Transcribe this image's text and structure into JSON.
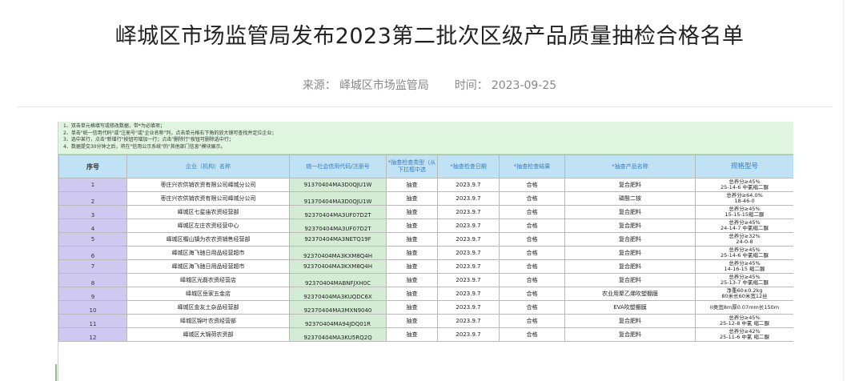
{
  "article": {
    "title": "峄城区市场监管局发布2023第二批次区级产品质量抽检合格名单",
    "source_label": "来源：",
    "source_value": "峄城区市场监管局",
    "time_label": "时间：",
    "time_value": "2023-09-25"
  },
  "sheet": {
    "notes": [
      "1、双击单元格填写或修改数据，带*为必填项；",
      "2、单击\"统一信用代码\"或\"注册号\"或\"企业名称\"列，点击单元格右下角的放大镜可查找并定位企业；",
      "3、选中某行，点击\"新增行\"按钮可增加一行；点击\"删除行\"按钮可删除选中行；",
      "4、数据提交30分钟之后，将在\"信用公示系统\"的\"其他部门信息\"模块展示。"
    ],
    "headers": [
      "序号",
      "企业（机构）名称",
      "统一社会信用代码/注册号",
      "*抽查检查类型（从下拉框中选",
      "*抽查检查日期",
      "*抽查检查结果",
      "*抽查产品名称",
      "规格型号"
    ],
    "rows": [
      {
        "seq": "1",
        "name": "枣庄兴农供销农资有限公司峄城分公司",
        "code": "91370404MA3D0QJU1W",
        "type": "抽查",
        "date": "2023.9.7",
        "result": "合格",
        "product": "复合肥料",
        "spec": "总养分≥45%\n25-14-6 中氯缩二脲",
        "low": false
      },
      {
        "seq": "2",
        "name": "枣庄兴农供销农资有限公司峄城分公司",
        "code": "91370404MA3D0QJU1W",
        "type": "抽查",
        "date": "2023.9.7",
        "result": "合格",
        "product": "磷酸二铵",
        "spec": "总养分≥64.0%\n18-46-0",
        "low": true
      },
      {
        "seq": "3",
        "name": "峄城区七星庙农资经营部",
        "code": "92370404MA3UF07D2T",
        "type": "抽查",
        "date": "2023.9.7",
        "result": "合格",
        "product": "复合肥料",
        "spec": "总养分≥45%\n15-15-15缩二脲",
        "low": true
      },
      {
        "seq": "4",
        "name": "峄城区左庄农资经营中心",
        "code": "92370404MA3UF07D2T",
        "type": "抽查",
        "date": "2023.9.7",
        "result": "合格",
        "product": "复合肥料",
        "spec": "总养分≥45%\n24-14-7 中氯缩二脲",
        "low": true
      },
      {
        "seq": "5",
        "name": "峄城区榴山镇为农农资销售经营部",
        "code": "92370404MA3NETQ19F",
        "type": "抽查",
        "date": "2023.9.7",
        "result": "合格",
        "product": "复合肥料",
        "spec": "总养分≥32%\n24-0-8",
        "low": false
      },
      {
        "seq": "6",
        "name": "峄城区海飞驰日用品经营超市",
        "code": "92370404MA3KXM8Q4H",
        "type": "抽查",
        "date": "2023.9.7",
        "result": "合格",
        "product": "复合肥料",
        "spec": "总养分≥45%\n25-14-6 中氯缩二脲",
        "low": true
      },
      {
        "seq": "7",
        "name": "峄城区海飞驰日用品经营超市",
        "code": "92370404MA3KXM8Q4H",
        "type": "抽查",
        "date": "2023.9.7",
        "result": "合格",
        "product": "复合肥料",
        "spec": "总养分≥45%\n14-16-15 缩二脲",
        "low": false
      },
      {
        "seq": "8",
        "name": "峄城区光磊农资经营店",
        "code": "92370404MABNFJXH0C",
        "type": "抽查",
        "date": "2023.9.7",
        "result": "合格",
        "product": "复合肥料",
        "spec": "总养分≥45%\n25-13-7 中氯缩二脲",
        "low": true
      },
      {
        "seq": "9",
        "name": "峄城区岳家五金店",
        "code": "92370404MA3KUQDC6X",
        "type": "抽查",
        "date": "2023.9.7",
        "result": "合格",
        "product": "农业用聚乙烯吹塑棚膜",
        "spec": "净重60±0.2kg\n80米长60米宽12丝",
        "low": true
      },
      {
        "seq": "10",
        "name": "峄城区金友土杂品经营部",
        "code": "92370404MA3MXN9040",
        "type": "抽查",
        "date": "2023.9.7",
        "result": "合格",
        "product": "EVA吹塑棚膜",
        "spec": "II类宽8m厚0.07mm长150m",
        "low": true
      },
      {
        "seq": "11",
        "name": "峄城区锦叶农资经营部",
        "code": "92370404MA94JDQ01R",
        "type": "抽查",
        "date": "2023.9.7",
        "result": "合格",
        "product": "复合肥料",
        "spec": "总养分≥45%\n25-12-8 中氯 缩二脲",
        "low": true
      },
      {
        "seq": "12",
        "name": "峄城区大锦荷农资部",
        "code": "92370404MA3KU5RQ2Q",
        "type": "抽查",
        "date": "2023.9.7",
        "result": "合格",
        "product": "复合肥料",
        "spec": "总养分≥42%\n25-11-6 中氯 缩二脲",
        "low": true
      }
    ]
  },
  "colors": {
    "header_bg": "#bfe3f5",
    "seq_bg": "#cfc9f1",
    "code_bg": "#d3ecd3",
    "notes_bg": "#dff5e0"
  }
}
